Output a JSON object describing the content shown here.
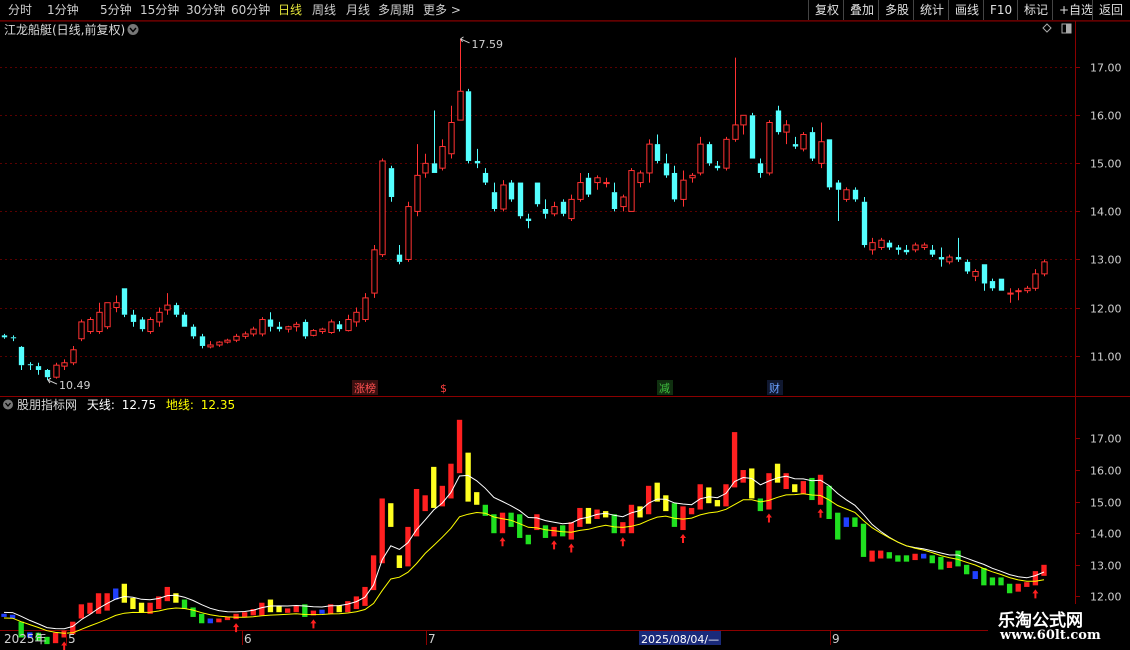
{
  "periods": [
    {
      "label": "分时",
      "active": false
    },
    {
      "label": "1分钟",
      "active": false
    },
    {
      "label": "5分钟",
      "active": false
    },
    {
      "label": "15分钟",
      "active": false
    },
    {
      "label": "30分钟",
      "active": false
    },
    {
      "label": "60分钟",
      "active": false
    },
    {
      "label": "日线",
      "active": true
    },
    {
      "label": "周线",
      "active": false
    },
    {
      "label": "月线",
      "active": false
    },
    {
      "label": "多周期",
      "active": false
    },
    {
      "label": "更多 >",
      "active": false
    }
  ],
  "tools": [
    "复权",
    "叠加",
    "多股",
    "统计",
    "画线",
    "F10",
    "标记",
    "+自选",
    "返回"
  ],
  "main_title": "江龙船艇(日线,前复权)",
  "sub_title": {
    "name": "股朋指标网",
    "tian_label": "天线:",
    "tian_value": "12.75",
    "di_label": "地线:",
    "di_value": "12.35"
  },
  "events": [
    {
      "label": "涨榜",
      "color": "#ff5050",
      "bg": "#3a1010"
    },
    {
      "label": "$",
      "color": "#ff4040",
      "bg": ""
    },
    {
      "label": "减",
      "color": "#40c040",
      "bg": "#103010"
    },
    {
      "label": "财",
      "color": "#6aa0ff",
      "bg": "#101830"
    }
  ],
  "x_axis": {
    "year": "2025年",
    "months": [
      "5",
      "6",
      "7",
      "8",
      "9"
    ],
    "cursor_date": "2025/08/04/—"
  },
  "watermark": {
    "line1": "乐淘公式网",
    "line2": "www.60lt.com"
  },
  "chart_data": [
    {
      "type": "candlestick",
      "title": "江龙船艇(日线,前复权)",
      "y_ticks": [
        11.0,
        12.0,
        13.0,
        14.0,
        15.0,
        16.0,
        17.0
      ],
      "ylim": [
        10.2,
        17.9
      ],
      "annotations": [
        {
          "label": "17.59",
          "value": 17.59
        },
        {
          "label": "10.49",
          "value": 10.49
        }
      ],
      "colors": {
        "up": "#ff3232",
        "down": "#54ffff",
        "grid": "#5a0000"
      },
      "ohlc": [
        [
          11.42,
          11.45,
          11.35,
          11.38
        ],
        [
          11.38,
          11.42,
          11.3,
          11.36
        ],
        [
          11.18,
          11.2,
          10.7,
          10.8
        ],
        [
          10.82,
          10.86,
          10.7,
          10.8
        ],
        [
          10.78,
          10.85,
          10.6,
          10.7
        ],
        [
          10.7,
          10.72,
          10.49,
          10.55
        ],
        [
          10.55,
          10.85,
          10.52,
          10.8
        ],
        [
          10.78,
          10.92,
          10.7,
          10.85
        ],
        [
          10.85,
          11.2,
          10.8,
          11.12
        ],
        [
          11.35,
          11.75,
          11.3,
          11.7
        ],
        [
          11.5,
          11.8,
          11.45,
          11.75
        ],
        [
          11.5,
          12.1,
          11.45,
          11.9
        ],
        [
          11.6,
          12.1,
          11.55,
          12.1
        ],
        [
          12.0,
          12.25,
          11.9,
          12.1
        ],
        [
          12.4,
          12.4,
          11.8,
          11.85
        ],
        [
          11.85,
          11.95,
          11.6,
          11.7
        ],
        [
          11.75,
          11.8,
          11.5,
          11.55
        ],
        [
          11.5,
          11.8,
          11.45,
          11.75
        ],
        [
          11.7,
          12.0,
          11.6,
          11.9
        ],
        [
          11.95,
          12.3,
          11.85,
          12.05
        ],
        [
          12.05,
          12.1,
          11.8,
          11.85
        ],
        [
          11.85,
          11.9,
          11.6,
          11.6
        ],
        [
          11.6,
          11.65,
          11.35,
          11.4
        ],
        [
          11.4,
          11.45,
          11.15,
          11.2
        ],
        [
          11.18,
          11.3,
          11.15,
          11.22
        ],
        [
          11.22,
          11.3,
          11.18,
          11.28
        ],
        [
          11.28,
          11.35,
          11.25,
          11.32
        ],
        [
          11.32,
          11.45,
          11.28,
          11.4
        ],
        [
          11.4,
          11.5,
          11.35,
          11.45
        ],
        [
          11.45,
          11.6,
          11.4,
          11.55
        ],
        [
          11.45,
          11.8,
          11.4,
          11.75
        ],
        [
          11.75,
          11.9,
          11.5,
          11.6
        ],
        [
          11.6,
          11.7,
          11.5,
          11.55
        ],
        [
          11.55,
          11.62,
          11.48,
          11.6
        ],
        [
          11.6,
          11.7,
          11.5,
          11.65
        ],
        [
          11.7,
          11.75,
          11.35,
          11.4
        ],
        [
          11.42,
          11.55,
          11.4,
          11.52
        ],
        [
          11.5,
          11.58,
          11.45,
          11.55
        ],
        [
          11.48,
          11.75,
          11.45,
          11.7
        ],
        [
          11.65,
          11.72,
          11.5,
          11.55
        ],
        [
          11.52,
          11.85,
          11.5,
          11.75
        ],
        [
          11.7,
          12.0,
          11.6,
          11.9
        ],
        [
          11.75,
          12.3,
          11.7,
          12.2
        ],
        [
          12.3,
          13.3,
          12.2,
          13.2
        ],
        [
          13.1,
          15.1,
          13.05,
          15.05
        ],
        [
          14.9,
          14.95,
          14.2,
          14.3
        ],
        [
          13.1,
          13.3,
          12.9,
          12.95
        ],
        [
          13.0,
          14.2,
          12.95,
          14.1
        ],
        [
          14.0,
          15.4,
          13.9,
          14.75
        ],
        [
          14.8,
          15.2,
          14.7,
          15.0
        ],
        [
          15.0,
          16.1,
          14.8,
          14.8
        ],
        [
          14.9,
          15.5,
          14.85,
          15.35
        ],
        [
          15.2,
          16.2,
          15.1,
          15.85
        ],
        [
          15.9,
          17.59,
          15.9,
          16.5
        ],
        [
          16.5,
          16.55,
          15.0,
          15.05
        ],
        [
          15.05,
          15.3,
          14.9,
          15.0
        ],
        [
          14.8,
          14.9,
          14.55,
          14.6
        ],
        [
          14.4,
          14.6,
          14.0,
          14.05
        ],
        [
          14.05,
          14.65,
          14.0,
          14.55
        ],
        [
          14.6,
          14.65,
          14.2,
          14.25
        ],
        [
          14.6,
          14.6,
          13.85,
          13.9
        ],
        [
          13.85,
          13.95,
          13.65,
          13.8
        ],
        [
          14.6,
          14.6,
          14.1,
          14.15
        ],
        [
          14.05,
          14.25,
          13.85,
          13.95
        ],
        [
          13.95,
          14.2,
          13.9,
          14.1
        ],
        [
          14.2,
          14.25,
          13.9,
          13.95
        ],
        [
          13.85,
          14.35,
          13.8,
          14.25
        ],
        [
          14.25,
          14.8,
          14.2,
          14.6
        ],
        [
          14.7,
          14.8,
          14.3,
          14.35
        ],
        [
          14.6,
          14.75,
          14.45,
          14.7
        ],
        [
          14.6,
          14.7,
          14.5,
          14.6
        ],
        [
          14.4,
          14.6,
          14.0,
          14.05
        ],
        [
          14.1,
          14.35,
          14.0,
          14.3
        ],
        [
          14.0,
          14.9,
          14.0,
          14.85
        ],
        [
          14.6,
          14.85,
          14.5,
          14.8
        ],
        [
          14.8,
          15.5,
          14.6,
          15.4
        ],
        [
          15.4,
          15.6,
          15.0,
          15.05
        ],
        [
          15.0,
          15.2,
          14.7,
          14.75
        ],
        [
          14.8,
          14.95,
          14.2,
          14.25
        ],
        [
          14.25,
          14.85,
          14.1,
          14.65
        ],
        [
          14.7,
          14.8,
          14.6,
          14.75
        ],
        [
          14.8,
          15.55,
          14.75,
          15.4
        ],
        [
          15.4,
          15.45,
          14.95,
          15.0
        ],
        [
          14.95,
          15.05,
          14.85,
          14.9
        ],
        [
          14.9,
          15.55,
          14.85,
          15.5
        ],
        [
          15.5,
          17.2,
          15.45,
          15.8
        ],
        [
          15.8,
          16.0,
          15.6,
          16.0
        ],
        [
          16.0,
          16.05,
          15.1,
          15.1
        ],
        [
          15.0,
          15.1,
          14.7,
          14.8
        ],
        [
          14.8,
          15.9,
          14.75,
          15.85
        ],
        [
          16.1,
          16.2,
          15.6,
          15.65
        ],
        [
          15.65,
          15.9,
          15.4,
          15.8
        ],
        [
          15.4,
          15.55,
          15.3,
          15.35
        ],
        [
          15.3,
          15.65,
          15.25,
          15.6
        ],
        [
          15.65,
          15.75,
          15.05,
          15.1
        ],
        [
          15.0,
          15.85,
          14.9,
          15.45
        ],
        [
          15.5,
          15.5,
          14.45,
          14.5
        ],
        [
          14.6,
          14.65,
          13.8,
          14.45
        ],
        [
          14.25,
          14.5,
          14.2,
          14.45
        ],
        [
          14.45,
          14.5,
          14.2,
          14.25
        ],
        [
          14.2,
          14.3,
          13.25,
          13.3
        ],
        [
          13.2,
          13.45,
          13.1,
          13.35
        ],
        [
          13.25,
          13.45,
          13.2,
          13.4
        ],
        [
          13.35,
          13.4,
          13.2,
          13.25
        ],
        [
          13.25,
          13.3,
          13.1,
          13.2
        ],
        [
          13.2,
          13.3,
          13.1,
          13.15
        ],
        [
          13.2,
          13.35,
          13.15,
          13.3
        ],
        [
          13.25,
          13.35,
          13.2,
          13.3
        ],
        [
          13.2,
          13.3,
          13.05,
          13.1
        ],
        [
          13.05,
          13.25,
          12.85,
          13.0
        ],
        [
          12.95,
          13.1,
          12.9,
          13.05
        ],
        [
          13.05,
          13.45,
          12.95,
          13.0
        ],
        [
          12.95,
          13.0,
          12.7,
          12.75
        ],
        [
          12.65,
          12.8,
          12.55,
          12.75
        ],
        [
          12.9,
          12.9,
          12.35,
          12.5
        ],
        [
          12.55,
          12.6,
          12.35,
          12.4
        ],
        [
          12.6,
          12.6,
          12.35,
          12.35
        ],
        [
          12.3,
          12.4,
          12.1,
          12.3
        ],
        [
          12.35,
          12.4,
          12.15,
          12.35
        ],
        [
          12.35,
          12.45,
          12.3,
          12.4
        ],
        [
          12.4,
          12.8,
          12.35,
          12.7
        ],
        [
          12.7,
          13.0,
          12.65,
          12.95
        ]
      ]
    },
    {
      "type": "bar",
      "title": "股朋指标网",
      "y_ticks": [
        12.0,
        13.0,
        14.0,
        15.0,
        16.0,
        17.0
      ],
      "ylim": [
        11.0,
        17.9
      ],
      "series": [
        {
          "name": "天线",
          "color": "#ffffff",
          "values": []
        },
        {
          "name": "地线",
          "color": "#ffff00",
          "values": []
        }
      ],
      "bar_colors": {
        "rising": "#ff2020",
        "falling_above": "#ffff20",
        "falling_below": "#20e020",
        "flat": "#2040ff"
      }
    }
  ]
}
